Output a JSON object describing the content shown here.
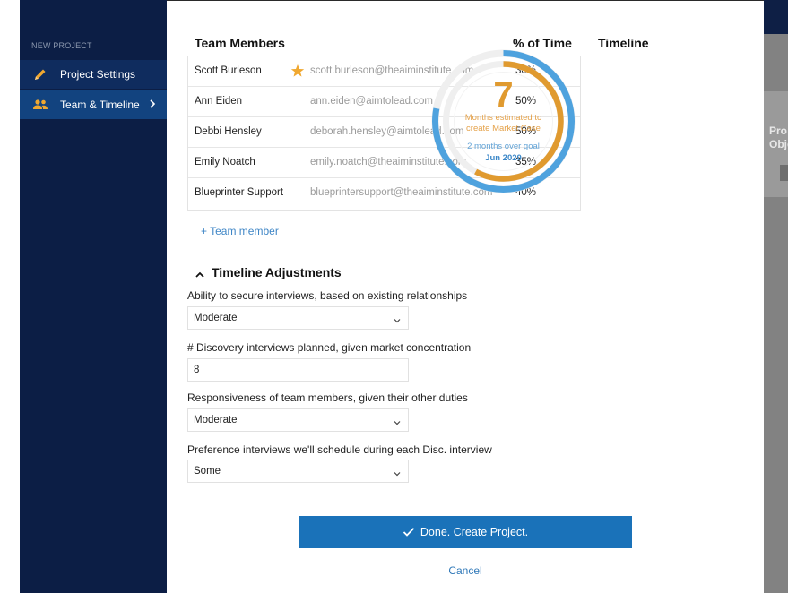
{
  "sidebar": {
    "heading": "NEW PROJECT",
    "items": [
      {
        "label": "Project Settings",
        "icon": "pencil-icon",
        "active": false
      },
      {
        "label": "Team & Timeline",
        "icon": "people-icon",
        "active": true
      }
    ]
  },
  "team": {
    "header_members": "Team Members",
    "header_pct": "% of Time",
    "members": [
      {
        "name": "Scott Burleson",
        "email": "scott.burleson@theaiminstitute.com",
        "pct": "30%",
        "starred": true
      },
      {
        "name": "Ann Eiden",
        "email": "ann.eiden@aimtolead.com",
        "pct": "50%",
        "starred": false
      },
      {
        "name": "Debbi Hensley",
        "email": "deborah.hensley@aimtolead.com",
        "pct": "50%",
        "starred": false
      },
      {
        "name": "Emily Noatch",
        "email": "emily.noatch@theaiminstitute.com",
        "pct": "35%",
        "starred": false
      },
      {
        "name": "Blueprinter Support",
        "email": "blueprintersupport@theaiminstitute.com",
        "pct": "40%",
        "starred": false
      }
    ],
    "add_label": "+ Team member"
  },
  "timeline": {
    "title": "Timeline",
    "months": "7",
    "line1": "Months estimated to",
    "line2": "create Market Case",
    "over_goal": "2 months over goal",
    "date": "Jun 2020",
    "goal_fraction": 0.78,
    "estimate_fraction": 0.58
  },
  "adjustments": {
    "title": "Timeline Adjustments",
    "fields": [
      {
        "label": "Ability to secure interviews, based on existing relationships",
        "value": "Moderate",
        "type": "select"
      },
      {
        "label": "# Discovery interviews planned, given market concentration",
        "value": "8",
        "type": "input"
      },
      {
        "label": "Responsiveness of team members, given their other duties",
        "value": "Moderate",
        "type": "select"
      },
      {
        "label": "Preference interviews we'll schedule during each Disc. interview",
        "value": "Some",
        "type": "select"
      }
    ]
  },
  "actions": {
    "done_label": "Done. Create Project.",
    "cancel_label": "Cancel"
  },
  "background_peek": {
    "line1": "Pro",
    "line2": "Obje"
  },
  "colors": {
    "sidebar": "#0c1e45",
    "sidebar_active": "#12437f",
    "accent_blue": "#1a72b9",
    "ring_orange": "#e09a2f",
    "ring_blue": "#4ea2de",
    "star": "#f0a830"
  }
}
